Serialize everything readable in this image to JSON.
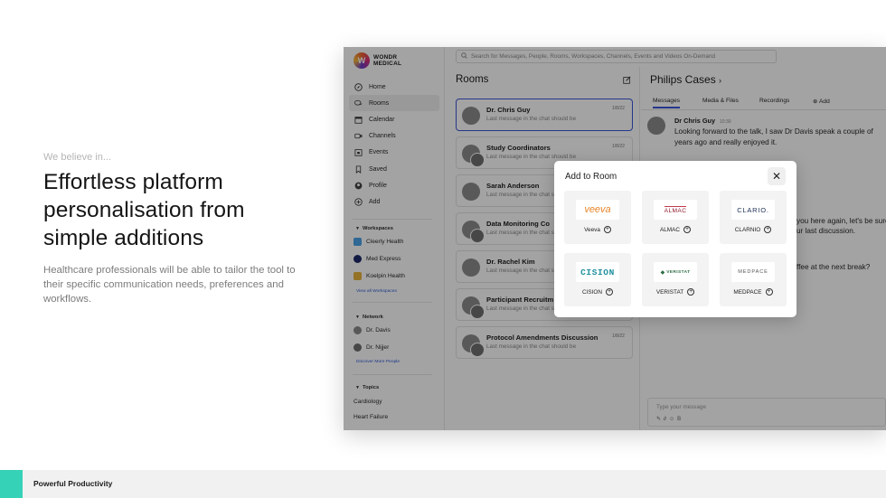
{
  "intro": {
    "eyebrow": "We believe in...",
    "headline_lines": [
      "Effortless platform",
      "personalisation from",
      "simple additions"
    ],
    "description": "Healthcare professionals will be able to tailor the tool to their specific communication needs, preferences and workflows."
  },
  "footer": {
    "label": "Powerful Productivity",
    "accent_color": "#35d2b7"
  },
  "app": {
    "logo": {
      "mark": "W",
      "line1": "WONDR",
      "line2": "MEDICAL"
    },
    "search_placeholder": "Search for Messages, People, Rooms, Workspaces, Channels, Events and Videos On-Demand",
    "nav": [
      {
        "label": "Home",
        "icon": "compass-icon"
      },
      {
        "label": "Rooms",
        "icon": "chat-bubbles-icon",
        "active": true
      },
      {
        "label": "Calendar",
        "icon": "calendar-icon"
      },
      {
        "label": "Channels",
        "icon": "video-icon"
      },
      {
        "label": "Events",
        "icon": "event-calendar-icon"
      },
      {
        "label": "Saved",
        "icon": "bookmark-icon"
      },
      {
        "label": "Profile",
        "icon": "profile-icon"
      },
      {
        "label": "Add",
        "icon": "plus-circle-icon"
      }
    ],
    "workspaces": {
      "title": "Workspaces",
      "items": [
        {
          "label": "Cleerly Health",
          "color": "#4aa3e8"
        },
        {
          "label": "Med Express",
          "color": "#1f2a6b"
        },
        {
          "label": "Koelpin Health",
          "color": "#e8b23c"
        }
      ],
      "link": "View all Workspaces"
    },
    "network": {
      "title": "Network",
      "items": [
        {
          "label": "Dr. Davis"
        },
        {
          "label": "Dr. Nijjer"
        }
      ],
      "link": "Discover More People"
    },
    "topics": {
      "title": "Topics",
      "items": [
        {
          "label": "Cardiology"
        },
        {
          "label": "Heart Failure"
        }
      ]
    },
    "rooms": {
      "title": "Rooms",
      "items": [
        {
          "name": "Dr. Chris Guy",
          "last": "Last message in the chat should be",
          "date": "1/8/22",
          "selected": true
        },
        {
          "name": "Study Coordinators",
          "last": "Last message in the chat should be",
          "date": "1/8/22"
        },
        {
          "name": "Sarah Anderson",
          "last": "Last message in the chat should be",
          "date": ""
        },
        {
          "name": "Data Monitoring Co",
          "last": "Last message in the chat should be",
          "date": ""
        },
        {
          "name": "Dr. Rachel Kim",
          "last": "Last message in the chat should be",
          "date": ""
        },
        {
          "name": "Participant Recruitm",
          "last": "Last message in the chat should be",
          "date": ""
        },
        {
          "name": "Protocol Amendments Discussion",
          "last": "Last message in the chat should be",
          "date": "1/8/22"
        }
      ]
    },
    "chat": {
      "title": "Philips Cases",
      "tabs": [
        "Messages",
        "Media & Files",
        "Recordings",
        "Add"
      ],
      "message": {
        "author": "Dr Chris Guy",
        "time": "10:30",
        "text": "Looking forward to the talk, I saw Dr Davis speak a couple of years ago and really enjoyed it."
      },
      "partial_lines": [
        "you here again, let's be sure",
        "ur last discussion.",
        "ffee at the next break?"
      ],
      "compose_placeholder": "Type your message"
    }
  },
  "modal": {
    "title": "Add to Room",
    "vendors": [
      {
        "name": "Veeva",
        "logo_text": "veeva"
      },
      {
        "name": "ALMAC",
        "logo_text": "ALMAC"
      },
      {
        "name": "CLARNIO",
        "logo_text": "CLARIO."
      },
      {
        "name": "CISION",
        "logo_text": "CISION"
      },
      {
        "name": "VERISTAT",
        "logo_text": "VERISTAT"
      },
      {
        "name": "MEDPACE",
        "logo_text": "MEDPACE"
      }
    ]
  }
}
